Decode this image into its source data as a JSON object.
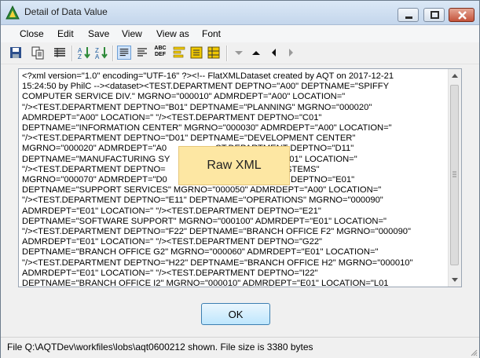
{
  "window": {
    "title": "Detail of Data Value"
  },
  "menu": {
    "items": [
      "Close",
      "Edit",
      "Save",
      "View",
      "View as",
      "Font"
    ]
  },
  "toolbar": {
    "icons": [
      "save-icon",
      "copy-icon",
      "columns-icon",
      "sort-asc-icon",
      "sort-desc-icon",
      "wrap-text-icon",
      "align-left-icon",
      "abc-def-icon",
      "align-bars-icon",
      "hex-view-icon",
      "grid-view-icon",
      "nav-down-icon",
      "nav-up-icon",
      "nav-prev-icon",
      "nav-next-icon"
    ],
    "abc_label_top": "ABC",
    "abc_label_bottom": "DEF"
  },
  "content": {
    "lines": [
      "<?xml version=\"1.0\" encoding=\"UTF-16\" ?><!-- FlatXMLDataset created by AQT on 2017-12-21",
      "15:24:50 by PhilC --><dataset><TEST.DEPARTMENT DEPTNO=\"A00\" DEPTNAME=\"SPIFFY",
      "COMPUTER SERVICE DIV.\" MGRNO=\"000010\" ADMRDEPT=\"A00\" LOCATION=\"",
      "\"/><TEST.DEPARTMENT DEPTNO=\"B01\" DEPTNAME=\"PLANNING\" MGRNO=\"000020\"",
      "ADMRDEPT=\"A00\" LOCATION=\" \"/><TEST.DEPARTMENT DEPTNO=\"C01\"",
      "DEPTNAME=\"INFORMATION CENTER\" MGRNO=\"000030\" ADMRDEPT=\"A00\" LOCATION=\"",
      "\"/><TEST.DEPARTMENT DEPTNO=\"D01\" DEPTNAME=\"DEVELOPMENT CENTER\"",
      "MGRNO=\"000020\" ADMRDEPT=\"A0                    ST.DEPARTMENT DEPTNO=\"D11\"",
      "DEPTNAME=\"MANUFACTURING SY                       ADMRDEPT=\"D01\" LOCATION=\"",
      "\"/><TEST.DEPARTMENT DEPTNO=                      NISTRATION SYSTEMS\"",
      "MGRNO=\"000070\" ADMRDEPT=\"D0                    ST.DEPARTMENT DEPTNO=\"E01\"",
      "DEPTNAME=\"SUPPORT SERVICES\" MGRNO=\"000050\" ADMRDEPT=\"A00\" LOCATION=\"",
      "\"/><TEST.DEPARTMENT DEPTNO=\"E11\" DEPTNAME=\"OPERATIONS\" MGRNO=\"000090\"",
      "ADMRDEPT=\"E01\" LOCATION=\" \"/><TEST.DEPARTMENT DEPTNO=\"E21\"",
      "DEPTNAME=\"SOFTWARE SUPPORT\" MGRNO=\"000100\" ADMRDEPT=\"E01\" LOCATION=\"",
      "\"/><TEST.DEPARTMENT DEPTNO=\"F22\" DEPTNAME=\"BRANCH OFFICE F2\" MGRNO=\"000090\"",
      "ADMRDEPT=\"E01\" LOCATION=\" \"/><TEST.DEPARTMENT DEPTNO=\"G22\"",
      "DEPTNAME=\"BRANCH OFFICE G2\" MGRNO=\"000060\" ADMRDEPT=\"E01\" LOCATION=\"",
      "\"/><TEST.DEPARTMENT DEPTNO=\"H22\" DEPTNAME=\"BRANCH OFFICE H2\" MGRNO=\"000010\"",
      "ADMRDEPT=\"E01\" LOCATION=\" \"/><TEST.DEPARTMENT DEPTNO=\"I22\"",
      "DEPTNAME=\"BRANCH OFFICE I2\" MGRNO=\"000010\" ADMRDEPT=\"E01\" LOCATION=\"L01"
    ]
  },
  "overlay": {
    "label": "Raw XML"
  },
  "buttons": {
    "ok_label": "OK"
  },
  "status": {
    "text": "File Q:\\AQTDev\\workfiles\\lobs\\aqt0600212 shown. File size is 3380 bytes"
  },
  "colors": {
    "overlay_bg": "#fde7a3",
    "ok_border": "#3c7fb1",
    "active_tool_bg": "#cfe3fb"
  }
}
